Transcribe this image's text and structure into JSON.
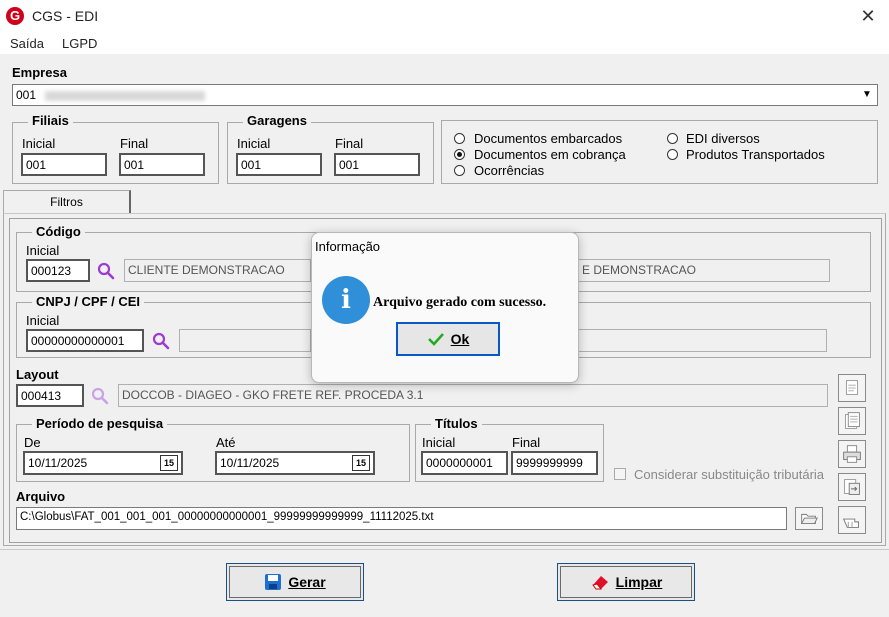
{
  "window": {
    "title": "CGS - EDI",
    "logo": "G"
  },
  "menu": [
    {
      "label": "Saída"
    },
    {
      "label": "LGPD"
    }
  ],
  "empresa": {
    "label": "Empresa",
    "value": "001"
  },
  "filiais": {
    "title": "Filiais",
    "inicial_label": "Inicial",
    "final_label": "Final",
    "inicial": "001",
    "final": "001"
  },
  "garagens": {
    "title": "Garagens",
    "inicial_label": "Inicial",
    "final_label": "Final",
    "inicial": "001",
    "final": "001"
  },
  "document_types": [
    {
      "label": "Documentos embarcados",
      "selected": false
    },
    {
      "label": "Documentos em cobrança",
      "selected": true
    },
    {
      "label": "Ocorrências",
      "selected": false
    },
    {
      "label": "EDI diversos",
      "selected": false
    },
    {
      "label": "Produtos Transportados",
      "selected": false
    }
  ],
  "tabs": [
    {
      "label": "Filtros",
      "active": true
    }
  ],
  "codigo": {
    "title": "Código",
    "inicial_label": "Inicial",
    "inicial": "000123",
    "name_left": "CLIENTE DEMONSTRACAO",
    "name_right": "E DEMONSTRACAO"
  },
  "cnpj": {
    "title": "CNPJ / CPF / CEI",
    "inicial_label": "Inicial",
    "inicial": "00000000000001"
  },
  "layout": {
    "label": "Layout",
    "code": "000413",
    "description": "DOCCOB - DIAGEO - GKO FRETE REF. PROCEDA 3.1"
  },
  "periodo": {
    "title": "Período de pesquisa",
    "de_label": "De",
    "ate_label": "Até",
    "de": "10/11/2025",
    "ate": "10/11/2025",
    "cal_glyph": "15"
  },
  "titulos": {
    "title": "Títulos",
    "inicial_label": "Inicial",
    "final_label": "Final",
    "inicial": "0000000001",
    "final": "9999999999"
  },
  "substituicao": {
    "label": "Considerar substituição tributária",
    "checked": false
  },
  "arquivo": {
    "label": "Arquivo",
    "value": "C:\\Globus\\FAT_001_001_001_00000000000001_99999999999999_11112025.txt"
  },
  "buttons": {
    "gerar": "Gerar",
    "limpar": "Limpar"
  },
  "dialog": {
    "title": "Informação",
    "message": "Arquivo gerado com sucesso.",
    "ok": "Ok"
  },
  "colors": {
    "accent": "#2f8fd8",
    "logo": "#d0021b",
    "search": "#9b3bd1",
    "ok_check": "#22aa22"
  }
}
